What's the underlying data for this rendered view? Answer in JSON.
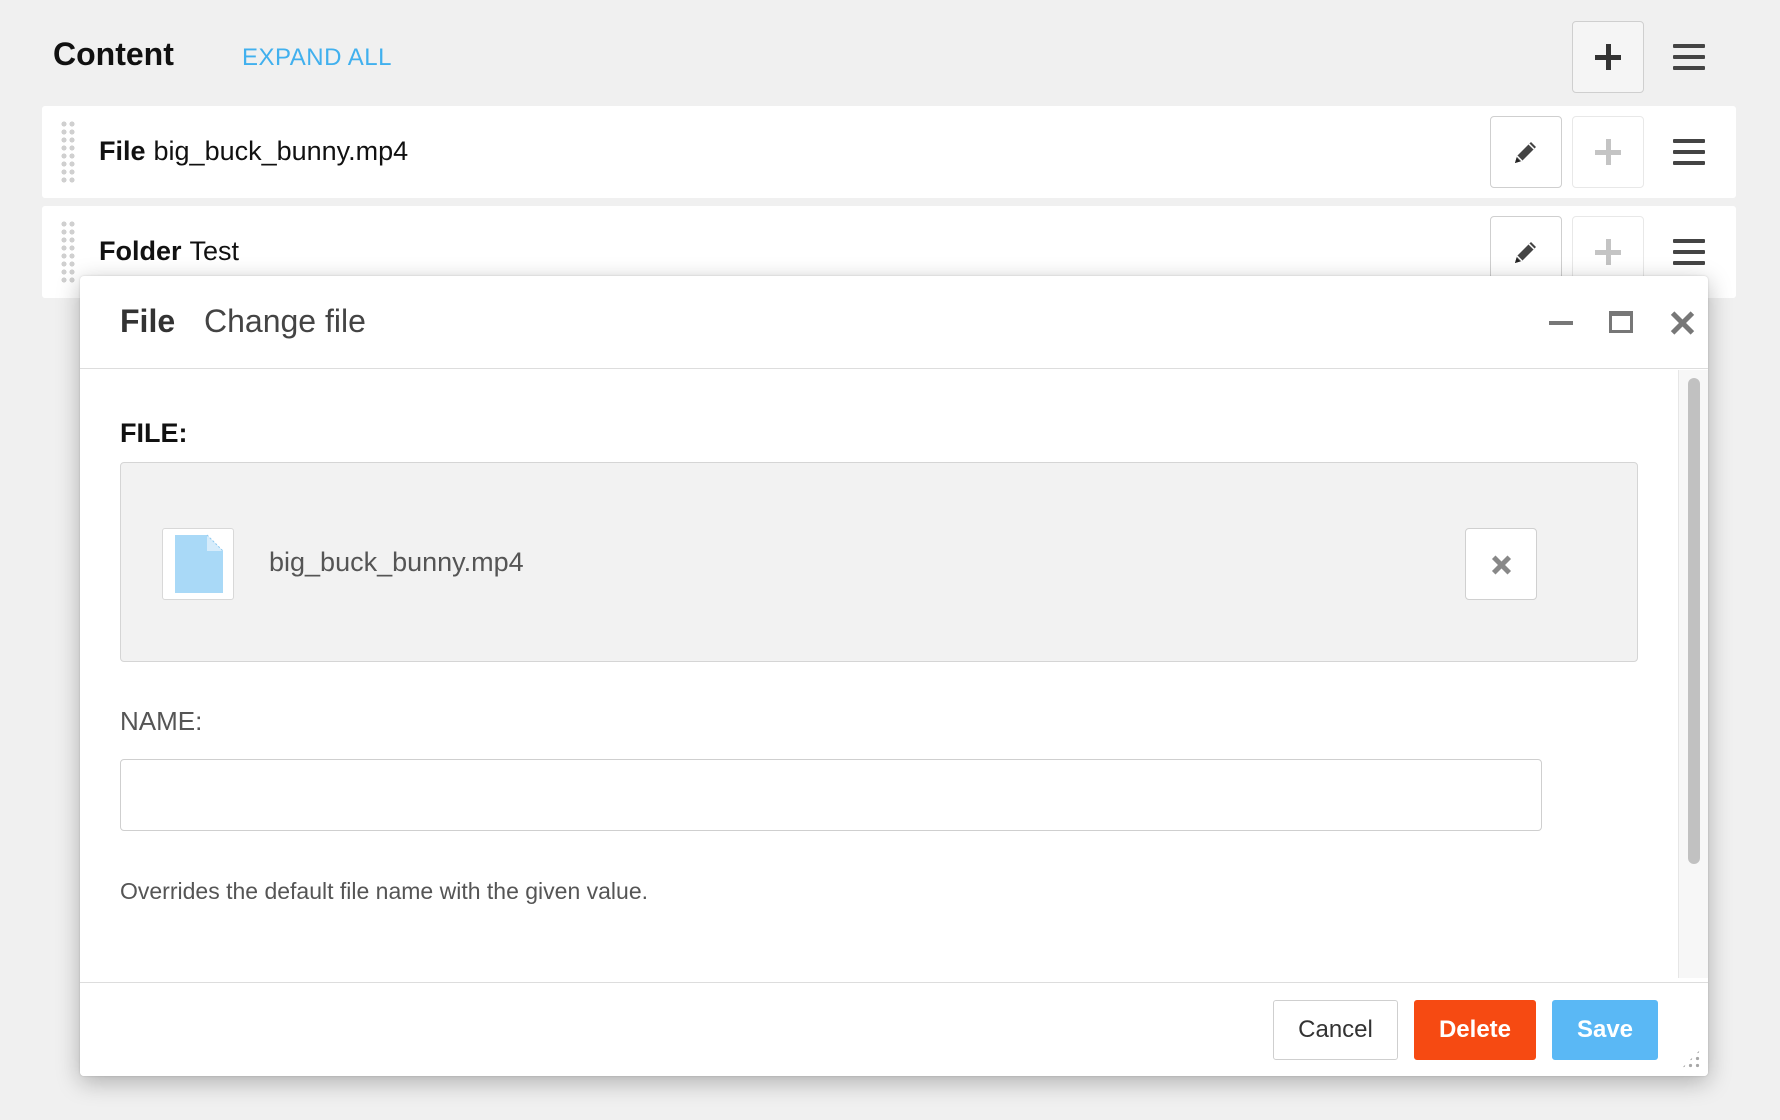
{
  "header": {
    "title": "Content",
    "expand_all": "EXPAND ALL",
    "add_icon": "plus-icon",
    "menu_icon": "hamburger-icon"
  },
  "rows": [
    {
      "type": "File",
      "name": "big_buck_bunny.mp4"
    },
    {
      "type": "Folder",
      "name": "Test"
    }
  ],
  "modal": {
    "title": "File",
    "subtitle": "Change file",
    "file_label": "FILE:",
    "file_name": "big_buck_bunny.mp4",
    "name_label": "NAME:",
    "name_value": "",
    "name_placeholder": "",
    "help_text": "Overrides the default file name with the given value.",
    "buttons": {
      "cancel": "Cancel",
      "delete": "Delete",
      "save": "Save"
    }
  },
  "colors": {
    "accent": "#41b0ee",
    "delete": "#f64a12",
    "save": "#5ab8f5",
    "file_icon": "#a9d9f7",
    "background": "#f0f0f0"
  }
}
